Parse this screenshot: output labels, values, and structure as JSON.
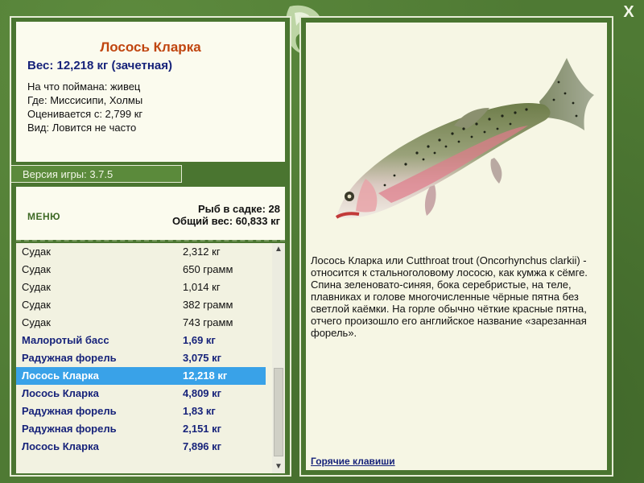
{
  "window": {
    "close_label": "X"
  },
  "fish_card": {
    "title": "Лосось Кларка",
    "weight": "Вес: 12,218 кг (зачетная)",
    "details": [
      "На что поймана: живец",
      "Где: Миссисипи, Холмы",
      "Оценивается с: 2,799 кг",
      "Вид: Ловится не часто"
    ]
  },
  "version": "Версия игры: 3.7.5",
  "menu": {
    "label": "МЕНЮ"
  },
  "stats": {
    "fish_count": "Рыб в садке: 28",
    "total_weight": "Общий вес: 60,833 кг"
  },
  "catch_list": [
    {
      "name": "Судак",
      "weight": "2,312 кг",
      "style": "normal"
    },
    {
      "name": "Судак",
      "weight": "650 грамм",
      "style": "normal"
    },
    {
      "name": "Судак",
      "weight": "1,014 кг",
      "style": "normal"
    },
    {
      "name": "Судак",
      "weight": "382 грамм",
      "style": "normal"
    },
    {
      "name": "Судак",
      "weight": "743 грамм",
      "style": "normal"
    },
    {
      "name": "Малоротый басс",
      "weight": "1,69 кг",
      "style": "bold"
    },
    {
      "name": "Радужная форель",
      "weight": "3,075 кг",
      "style": "bold"
    },
    {
      "name": "Лосось Кларка",
      "weight": "12,218 кг",
      "style": "selected"
    },
    {
      "name": "Лосось Кларка",
      "weight": "4,809 кг",
      "style": "bold"
    },
    {
      "name": "Радужная форель",
      "weight": "1,83 кг",
      "style": "bold"
    },
    {
      "name": "Радужная форель",
      "weight": "2,151 кг",
      "style": "bold"
    },
    {
      "name": "Лосось Кларка",
      "weight": "7,896 кг",
      "style": "bold"
    }
  ],
  "description": "Лосось Кларка или Cutthroat trout (Oncorhynchus clarkii) - относится к стальноголовому лососю, как кумжа к сёмге. Спина зеленовато-синяя, бока серебристые, на теле, плавниках и голове многочисленные чёрные пятна без светлой каёмки. На горле обычно чёткие красные пятна, отчего произошло его английское название «зарезанная форель».",
  "hotkeys_label": "Горячие клавиши",
  "icons": {
    "close": "close-icon",
    "logo": "fish-logo-icon",
    "scroll_up": "chevron-up-icon",
    "scroll_down": "chevron-down-icon"
  },
  "colors": {
    "background": "#4f7a34",
    "panel": "#fbfbee",
    "title": "#c0450f",
    "accent_text": "#17237a",
    "selection": "#39a2e8"
  }
}
